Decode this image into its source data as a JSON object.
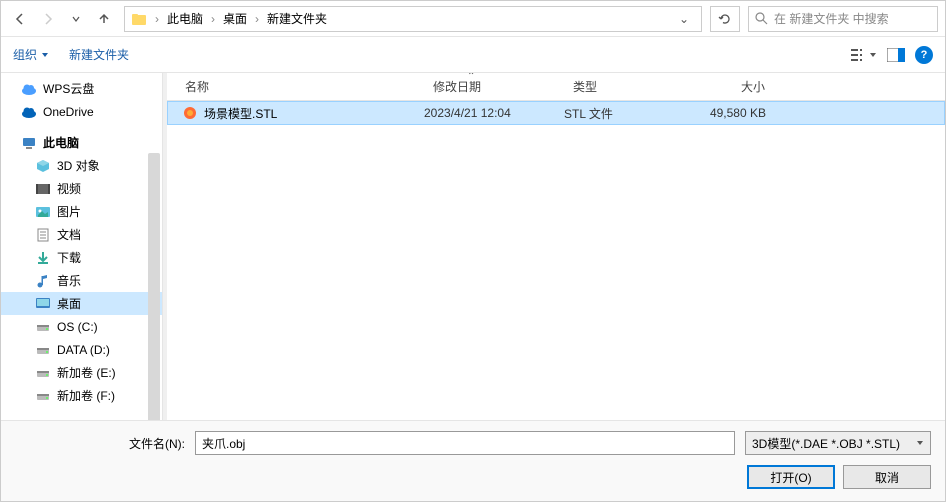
{
  "nav": {
    "breadcrumb": [
      "此电脑",
      "桌面",
      "新建文件夹"
    ]
  },
  "search": {
    "placeholder": "在 新建文件夹 中搜索"
  },
  "toolbar": {
    "organize": "组织",
    "new_folder": "新建文件夹"
  },
  "sidebar": {
    "items": [
      {
        "label": "WPS云盘",
        "icon": "cloud-wps",
        "indent": false
      },
      {
        "label": "OneDrive",
        "icon": "cloud-onedrive",
        "indent": false
      },
      {
        "label": "此电脑",
        "icon": "computer",
        "indent": false,
        "bold": true,
        "group": true
      },
      {
        "label": "3D 对象",
        "icon": "3d",
        "indent": true
      },
      {
        "label": "视频",
        "icon": "video",
        "indent": true
      },
      {
        "label": "图片",
        "icon": "pictures",
        "indent": true
      },
      {
        "label": "文档",
        "icon": "documents",
        "indent": true
      },
      {
        "label": "下载",
        "icon": "downloads",
        "indent": true
      },
      {
        "label": "音乐",
        "icon": "music",
        "indent": true
      },
      {
        "label": "桌面",
        "icon": "desktop",
        "indent": true,
        "selected": true
      },
      {
        "label": "OS (C:)",
        "icon": "drive",
        "indent": true
      },
      {
        "label": "DATA (D:)",
        "icon": "drive",
        "indent": true
      },
      {
        "label": "新加卷 (E:)",
        "icon": "drive",
        "indent": true
      },
      {
        "label": "新加卷 (F:)",
        "icon": "drive",
        "indent": true
      }
    ]
  },
  "columns": {
    "name": "名称",
    "date": "修改日期",
    "type": "类型",
    "size": "大小"
  },
  "files": [
    {
      "name": "场景模型.STL",
      "date": "2023/4/21 12:04",
      "type": "STL 文件",
      "size": "49,580 KB",
      "selected": true
    }
  ],
  "bottom": {
    "filename_label": "文件名(N):",
    "filename_value": "夹爪.obj",
    "filter": "3D模型(*.DAE *.OBJ *.STL)",
    "open": "打开(O)",
    "cancel": "取消"
  }
}
